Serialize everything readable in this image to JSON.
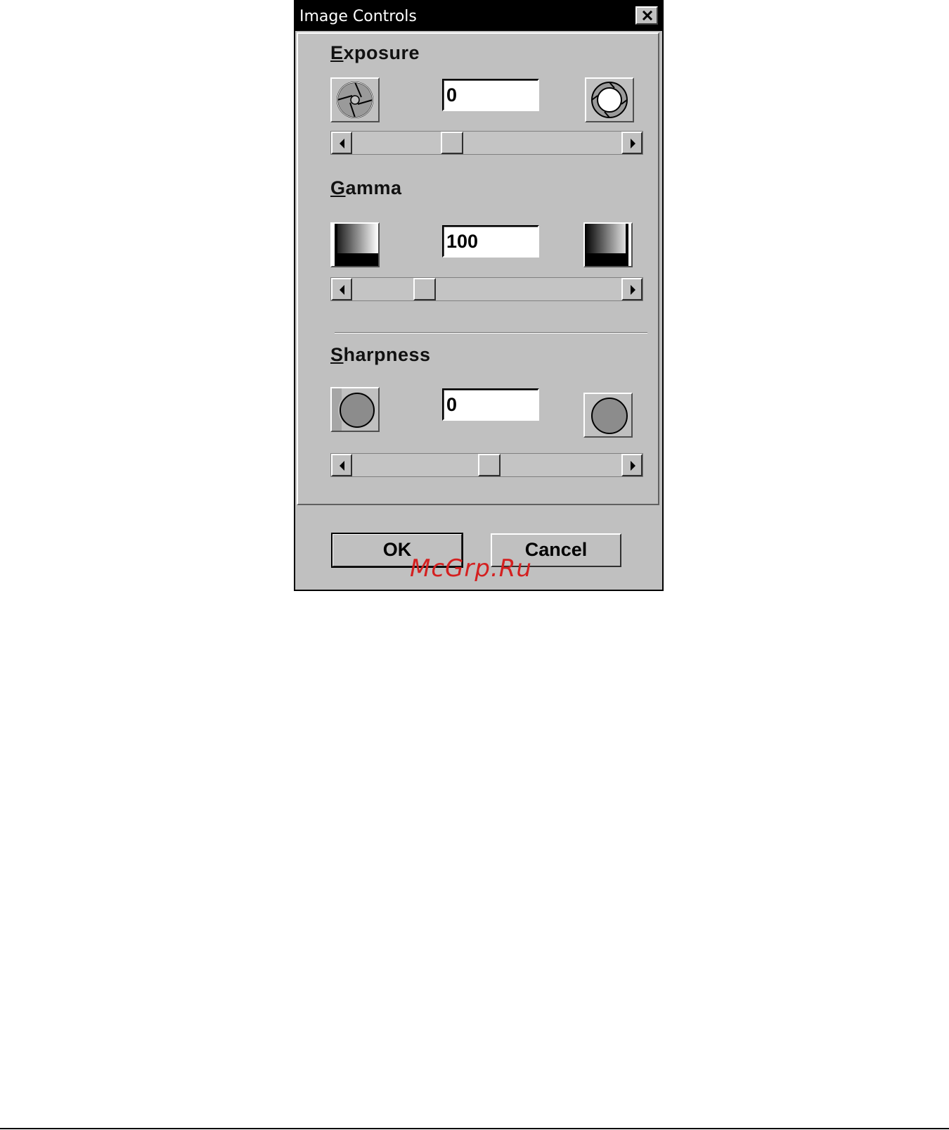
{
  "window": {
    "title": "Image Controls"
  },
  "sections": [
    {
      "id": "exposure",
      "label_mnemonic": "E",
      "label_rest": "xposure",
      "value": "0",
      "slider_level": 0.37
    },
    {
      "id": "gamma",
      "label_mnemonic": "G",
      "label_rest": "amma",
      "value": "100",
      "slider_level": 0.27
    },
    {
      "id": "sharpness",
      "label_mnemonic": "S",
      "label_rest": "harpness",
      "value": "0",
      "slider_level": 0.51
    }
  ],
  "buttons": {
    "ok": "OK",
    "cancel": "Cancel"
  },
  "watermark": "McGrp.Ru",
  "icons": {
    "exposure_left": "aperture-closed-icon",
    "exposure_right": "aperture-open-icon",
    "gamma_left": "gamma-low-icon",
    "gamma_right": "gamma-high-icon",
    "sharpness_left": "blur-circle-icon",
    "sharpness_right": "sharp-circle-icon"
  },
  "colors": {
    "dialog_face": "#c0c0c0",
    "titlebar": "#000000",
    "watermark": "#d42020"
  }
}
